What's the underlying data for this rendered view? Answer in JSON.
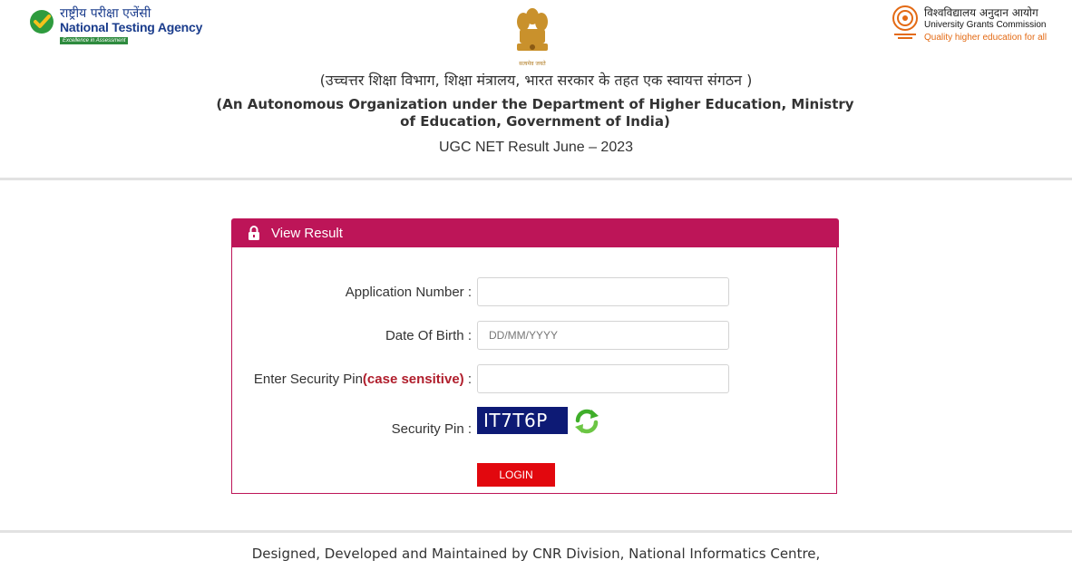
{
  "header": {
    "nta": {
      "hindi_name": "राष्ट्रीय परीक्षा एजेंसी",
      "english_name": "National Testing Agency",
      "tagline": "Excellence in Assessment"
    },
    "emblem": {
      "motto": "सत्यमेव जयते"
    },
    "ugc": {
      "hindi_name": "विश्वविद्यालय अनुदान आयोग",
      "english_name": "University Grants Commission",
      "tagline": "Quality higher education for all"
    },
    "org_hindi": "(उच्चत्तर शिक्षा विभाग, शिक्षा मंत्रालय, भारत सरकार के तहत एक स्वायत्त संगठन )",
    "org_english": "(An Autonomous Organization under the Department of Higher Education, Ministry of Education, Government of India)",
    "result_title": "UGC NET Result June – 2023"
  },
  "panel": {
    "title": "View Result",
    "application_label": "Application Number :",
    "application_value": "",
    "dob_label": "Date Of Birth :",
    "dob_placeholder": "DD/MM/YYYY",
    "dob_value": "",
    "pin_label_prefix": "Enter Security Pin",
    "pin_label_highlight": "(case sensitive)",
    "pin_label_suffix": " :",
    "pin_value": "",
    "captcha_label": "Security Pin :",
    "captcha_text": "IT7T6P",
    "login_label": "LOGIN"
  },
  "footer": {
    "text": "Designed, Developed and Maintained by CNR Division, National Informatics Centre,"
  },
  "colors": {
    "panel_header": "#bd1558",
    "login_button": "#e2080e",
    "captcha_bg": "#0d1a75",
    "highlight_red": "#b01e2c"
  }
}
